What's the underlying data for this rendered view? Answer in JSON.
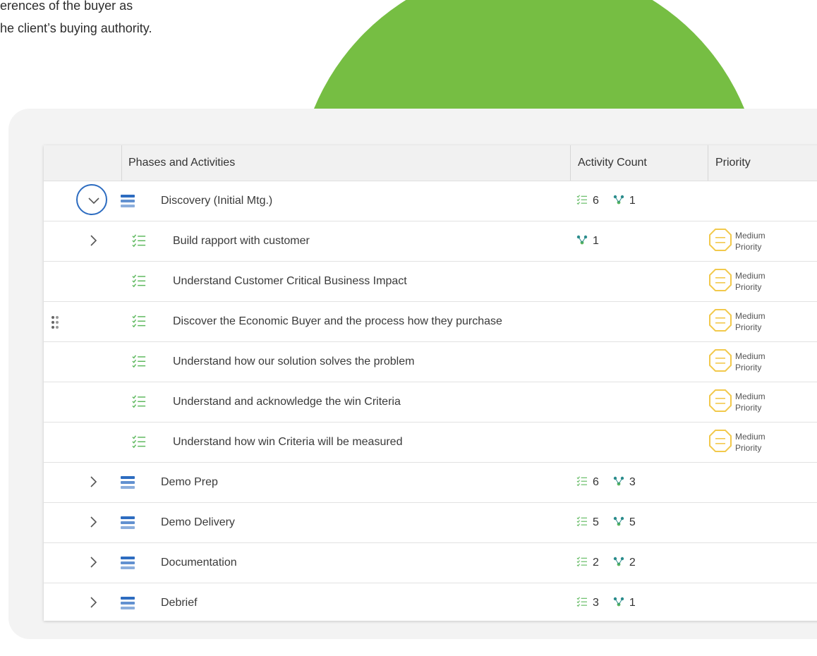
{
  "intro": {
    "line1": "erences of the buyer as",
    "line2": "he client’s buying authority."
  },
  "colors": {
    "accent_green": "#76be43",
    "icon_blue": "#2d6cc0",
    "check_green": "#5cb85c",
    "priority_yellow": "#f2c94c",
    "branch_teal": "#2a8c8c"
  },
  "table": {
    "headers": {
      "phase": "Phases and Activities",
      "count": "Activity Count",
      "priority": "Priority"
    },
    "rows": [
      {
        "kind": "phase",
        "title": "Discovery (Initial Mtg.)",
        "expanded": true,
        "activities": "6",
        "branches": "1"
      },
      {
        "kind": "activity",
        "title": "Build rapport with customer",
        "expandable": true,
        "branches": "1",
        "priority": [
          "Medium",
          "Priority"
        ]
      },
      {
        "kind": "activity",
        "title": "Understand Customer Critical Business Impact",
        "priority": [
          "Medium",
          "Priority"
        ]
      },
      {
        "kind": "activity",
        "title": "Discover the Economic Buyer and the process how they purchase",
        "drag": true,
        "priority": [
          "Medium",
          "Priority"
        ]
      },
      {
        "kind": "activity",
        "title": "Understand how our solution solves the problem",
        "priority": [
          "Medium",
          "Priority"
        ]
      },
      {
        "kind": "activity",
        "title": "Understand and acknowledge the win Criteria",
        "priority": [
          "Medium",
          "Priority"
        ]
      },
      {
        "kind": "activity",
        "title": "Understand how win Criteria will be measured",
        "priority": [
          "Medium",
          "Priority"
        ]
      },
      {
        "kind": "phase",
        "title": "Demo  Prep",
        "activities": "6",
        "branches": "3"
      },
      {
        "kind": "phase",
        "title": "Demo Delivery",
        "activities": "5",
        "branches": "5"
      },
      {
        "kind": "phase",
        "title": "Documentation",
        "activities": "2",
        "branches": "2"
      },
      {
        "kind": "phase",
        "title": "Debrief",
        "activities": "3",
        "branches": "1"
      }
    ]
  }
}
